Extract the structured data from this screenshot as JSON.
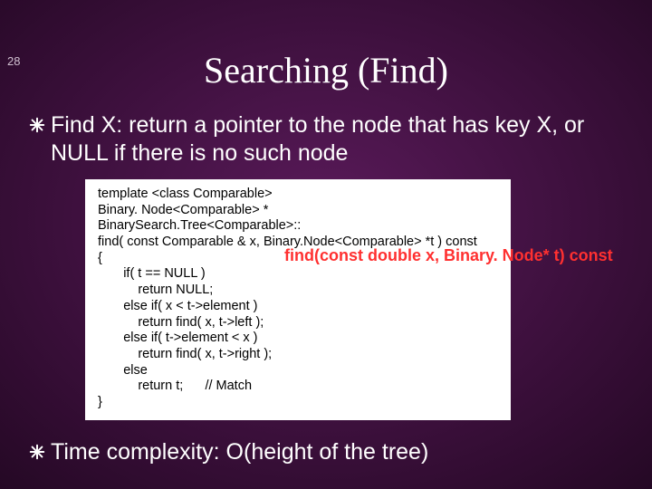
{
  "page_number": "28",
  "title": "Searching (Find)",
  "bullets": {
    "b1": "Find X: return a pointer to the node that has key X, or NULL if there is no such node",
    "b2": "Time complexity: O(height of the tree)"
  },
  "code_block": "template <class Comparable>\nBinary. Node<Comparable> *\nBinarySearch.Tree<Comparable>::\nfind( const Comparable & x, Binary.Node<Comparable> *t ) const\n{\n       if( t == NULL )\n           return NULL;\n       else if( x < t->element )\n           return find( x, t->left );\n       else if( t->element < x )\n           return find( x, t->right );\n       else\n           return t;      // Match\n}",
  "overlay_label": "find(const double x, Binary. Node* t) const",
  "icons": {
    "bullet": "asterisk-icon"
  }
}
